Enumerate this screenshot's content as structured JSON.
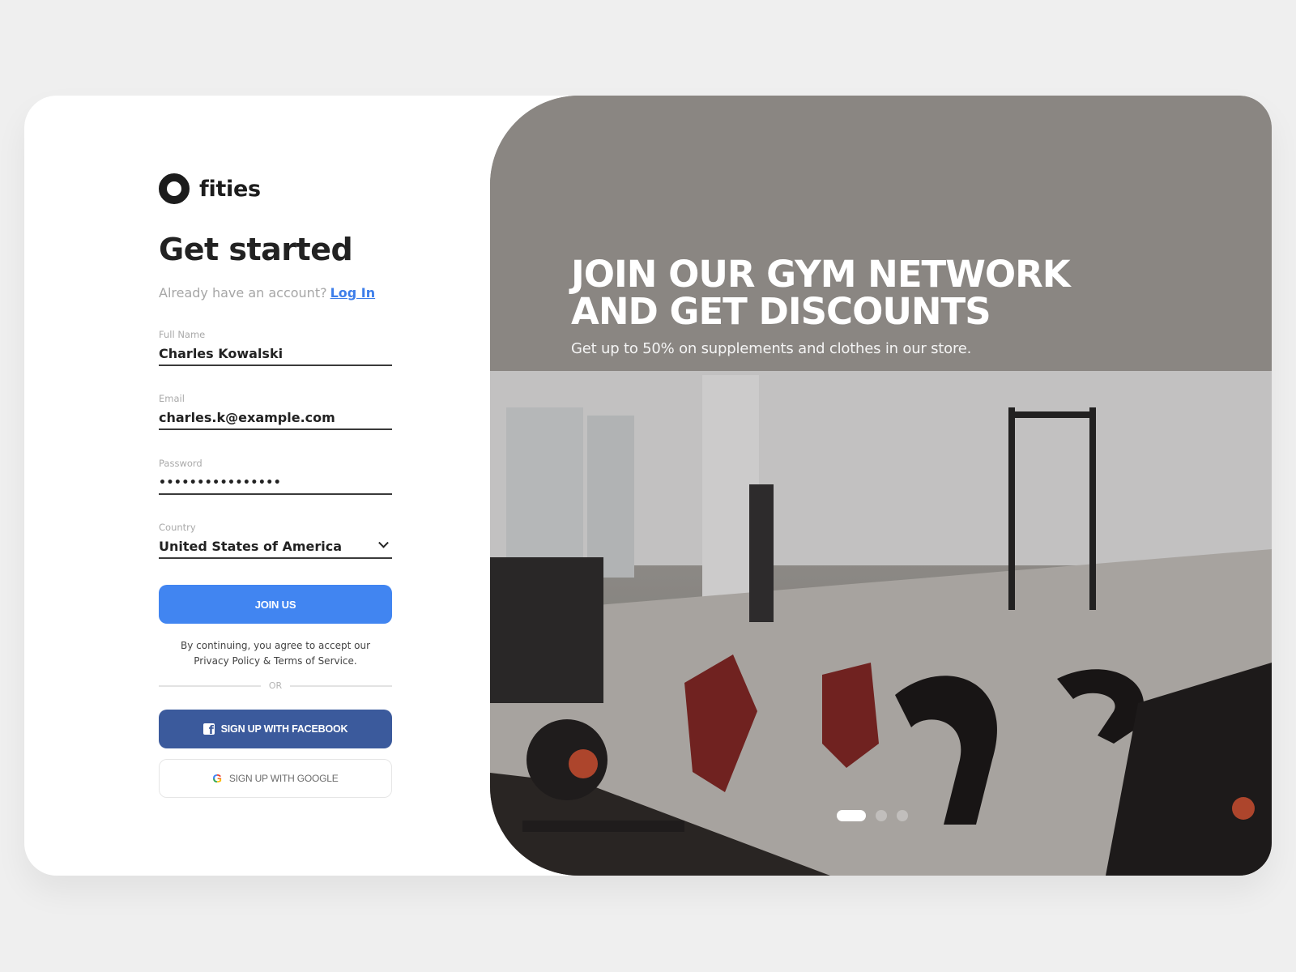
{
  "brand": {
    "name": "fities",
    "logo_icon": "ring-logo-icon"
  },
  "form": {
    "title": "Get started",
    "account_prompt": "Already have an account?",
    "login_link": "Log In",
    "fields": {
      "full_name": {
        "label": "Full Name",
        "value": "Charles Kowalski"
      },
      "email": {
        "label": "Email",
        "value": "charles.k@example.com"
      },
      "password": {
        "label": "Password",
        "value": "••••••••••••••••"
      },
      "country": {
        "label": "Country",
        "value": "United States of America",
        "icon": "chevron-down-icon"
      }
    },
    "join_button": "JOIN US",
    "terms_line1": "By continuing, you agree to accept our",
    "terms_line2": "Privacy Policy & Terms of Service.",
    "divider": "OR",
    "facebook_button": "SIGN UP WITH FACEBOOK",
    "google_button": "SIGN UP WITH GOOGLE"
  },
  "hero": {
    "heading": "JOIN  OUR GYM NETWORK\nAND GET DISCOUNTS",
    "subheading": "Get up to 50% on supplements and clothes in our store.",
    "image_description": "gym interior with exercise bikes, benches and weight racks",
    "carousel": {
      "total_slides": 3,
      "active_slide": 1
    }
  },
  "colors": {
    "primary": "#4185f1",
    "facebook": "#3b5a9c",
    "link": "#3d7eea",
    "background": "#efefef"
  }
}
